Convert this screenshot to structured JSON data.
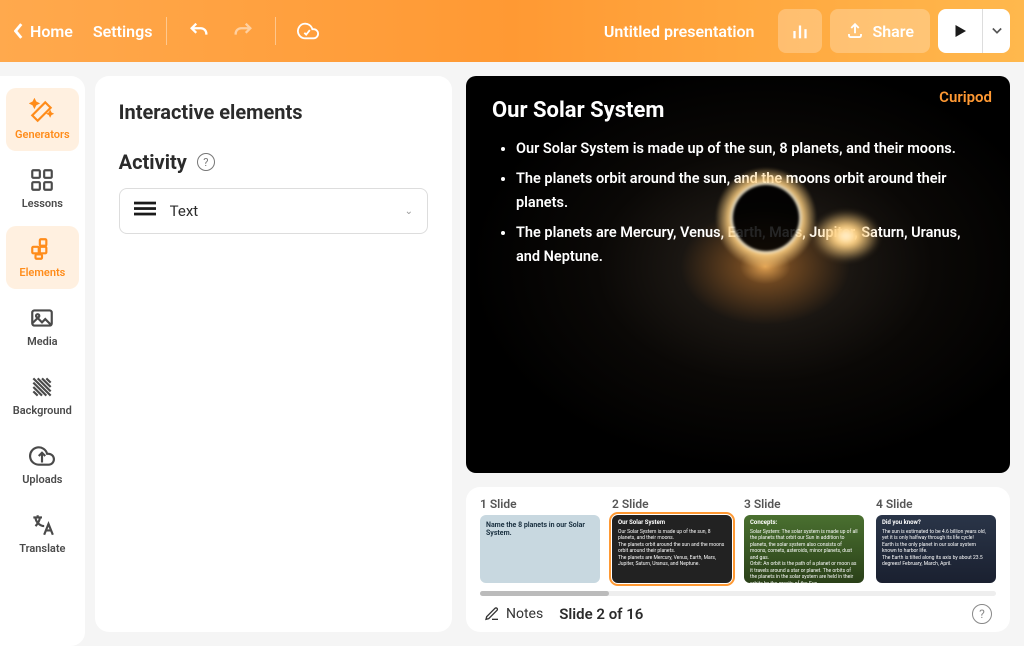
{
  "topbar": {
    "home": "Home",
    "settings": "Settings",
    "title": "Untitled presentation",
    "share": "Share"
  },
  "sidebar": {
    "items": [
      {
        "label": "Generators"
      },
      {
        "label": "Lessons"
      },
      {
        "label": "Elements"
      },
      {
        "label": "Media"
      },
      {
        "label": "Background"
      },
      {
        "label": "Uploads"
      },
      {
        "label": "Translate"
      }
    ]
  },
  "panel": {
    "title": "Interactive elements",
    "activity_label": "Activity",
    "activity_type": "Text"
  },
  "slide": {
    "brand": "Curipod",
    "title": "Our Solar System",
    "bullets": [
      "Our Solar System is made up of the sun, 8 planets, and their moons.",
      "The planets orbit around the sun, and the moons orbit around their planets.",
      "The planets are Mercury, Venus, Earth, Mars, Jupiter, Saturn, Uranus, and Neptune."
    ]
  },
  "thumbnails": [
    {
      "label": "1 Slide",
      "title": "Name the 8 planets in our Solar System."
    },
    {
      "label": "2 Slide",
      "title": "Our Solar System"
    },
    {
      "label": "3 Slide",
      "title": "Concepts:"
    },
    {
      "label": "4 Slide",
      "title": "Did you know?"
    }
  ],
  "bottom": {
    "notes": "Notes",
    "counter": "Slide 2 of 16"
  }
}
